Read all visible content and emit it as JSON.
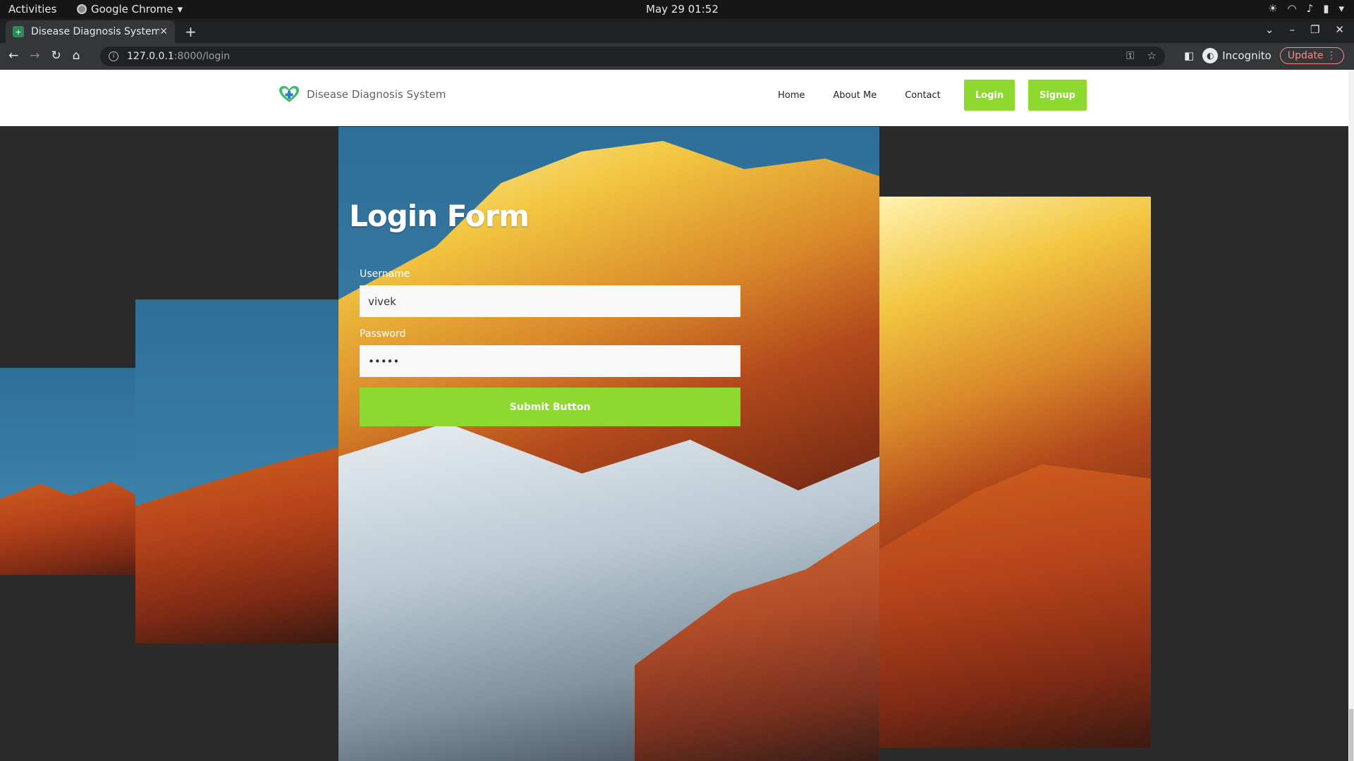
{
  "os": {
    "activities": "Activities",
    "app_name": "Google Chrome",
    "clock": "May 29  01:52"
  },
  "browser": {
    "tab_title": "Disease Diagnosis System",
    "url_host": "127.0.0.1",
    "url_path": ":8000/login",
    "profile_label": "Incognito",
    "update_label": "Update"
  },
  "site": {
    "brand": "Disease Diagnosis System",
    "nav": {
      "home": "Home",
      "about": "About Me",
      "contact": "Contact",
      "login": "Login",
      "signup": "Signup"
    },
    "accent_color": "#8ed92f"
  },
  "form": {
    "title": "Login Form",
    "username_label": "Username",
    "username_value": "vivek",
    "password_label": "Password",
    "password_value": "•••••",
    "submit_label": "Submit Button"
  }
}
